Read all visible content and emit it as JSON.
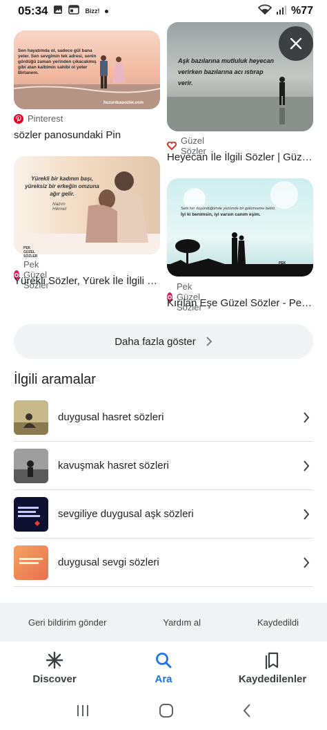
{
  "status_bar": {
    "time": "05:34",
    "notification_text": "Bizz!",
    "battery": "%77"
  },
  "results": [
    {
      "source": "Pinterest",
      "title": "sözler panosundaki Pin",
      "image_text": "Sen hayatımda ol, sadece gül bana yeter. Sen sevgimin tek adresi, senin gördüğü zaman yerinden çıkacakmış gibi atan kalbimin sahibi ol yeter Birtanem.",
      "image_watermark": "huzurduasozler.com"
    },
    {
      "source": "Güzel Sözler",
      "title": "Heyecan İle İlgili Sözler | Güzel Sözler",
      "image_text": "Aşk bazılarına mutluluk heyecan verirken bazılarına acı ıstırap verir."
    },
    {
      "source": "Pek Güzel Sözler",
      "title": "Yürekli Sözler, Yürek İle İlgili Sözler",
      "image_text": "Yürekli bir kadının başı, yüreksiz bir erkeğin omzuna ağır gelir.",
      "image_author": "Nazım Hikmet",
      "image_watermark": "PEK GÜZEL SÖZLER"
    },
    {
      "source": "Pek Güzel Sözler",
      "title": "Kırılan Eşe Güzel Sözler - Pek Güzel Sözler",
      "image_text_1": "Seni her düşündüğümde yüzümde bir gülümseme belirir.",
      "image_text_2": "İyi ki benimsin, iyi varsın canım eşim.",
      "image_watermark": "PEK GÜZEL SÖZLER"
    }
  ],
  "show_more_label": "Daha fazla göster",
  "related": {
    "heading": "İlgili aramalar",
    "items": [
      {
        "label": "duygusal hasret sözleri"
      },
      {
        "label": "kavuşmak hasret sözleri"
      },
      {
        "label": "sevgiliye duygusal aşk sözleri"
      },
      {
        "label": "duygusal sevgi sözleri"
      }
    ]
  },
  "footer": {
    "feedback": "Geri bildirim gönder",
    "help": "Yardım al",
    "saved": "Kaydedildi"
  },
  "bottom_nav": {
    "discover": "Discover",
    "search": "Ara",
    "saved": "Kaydedilenler",
    "active": "search"
  },
  "colors": {
    "accent_blue": "#1a73e8",
    "pinterest_red": "#e60023",
    "chip_bg": "#f1f3f4"
  }
}
